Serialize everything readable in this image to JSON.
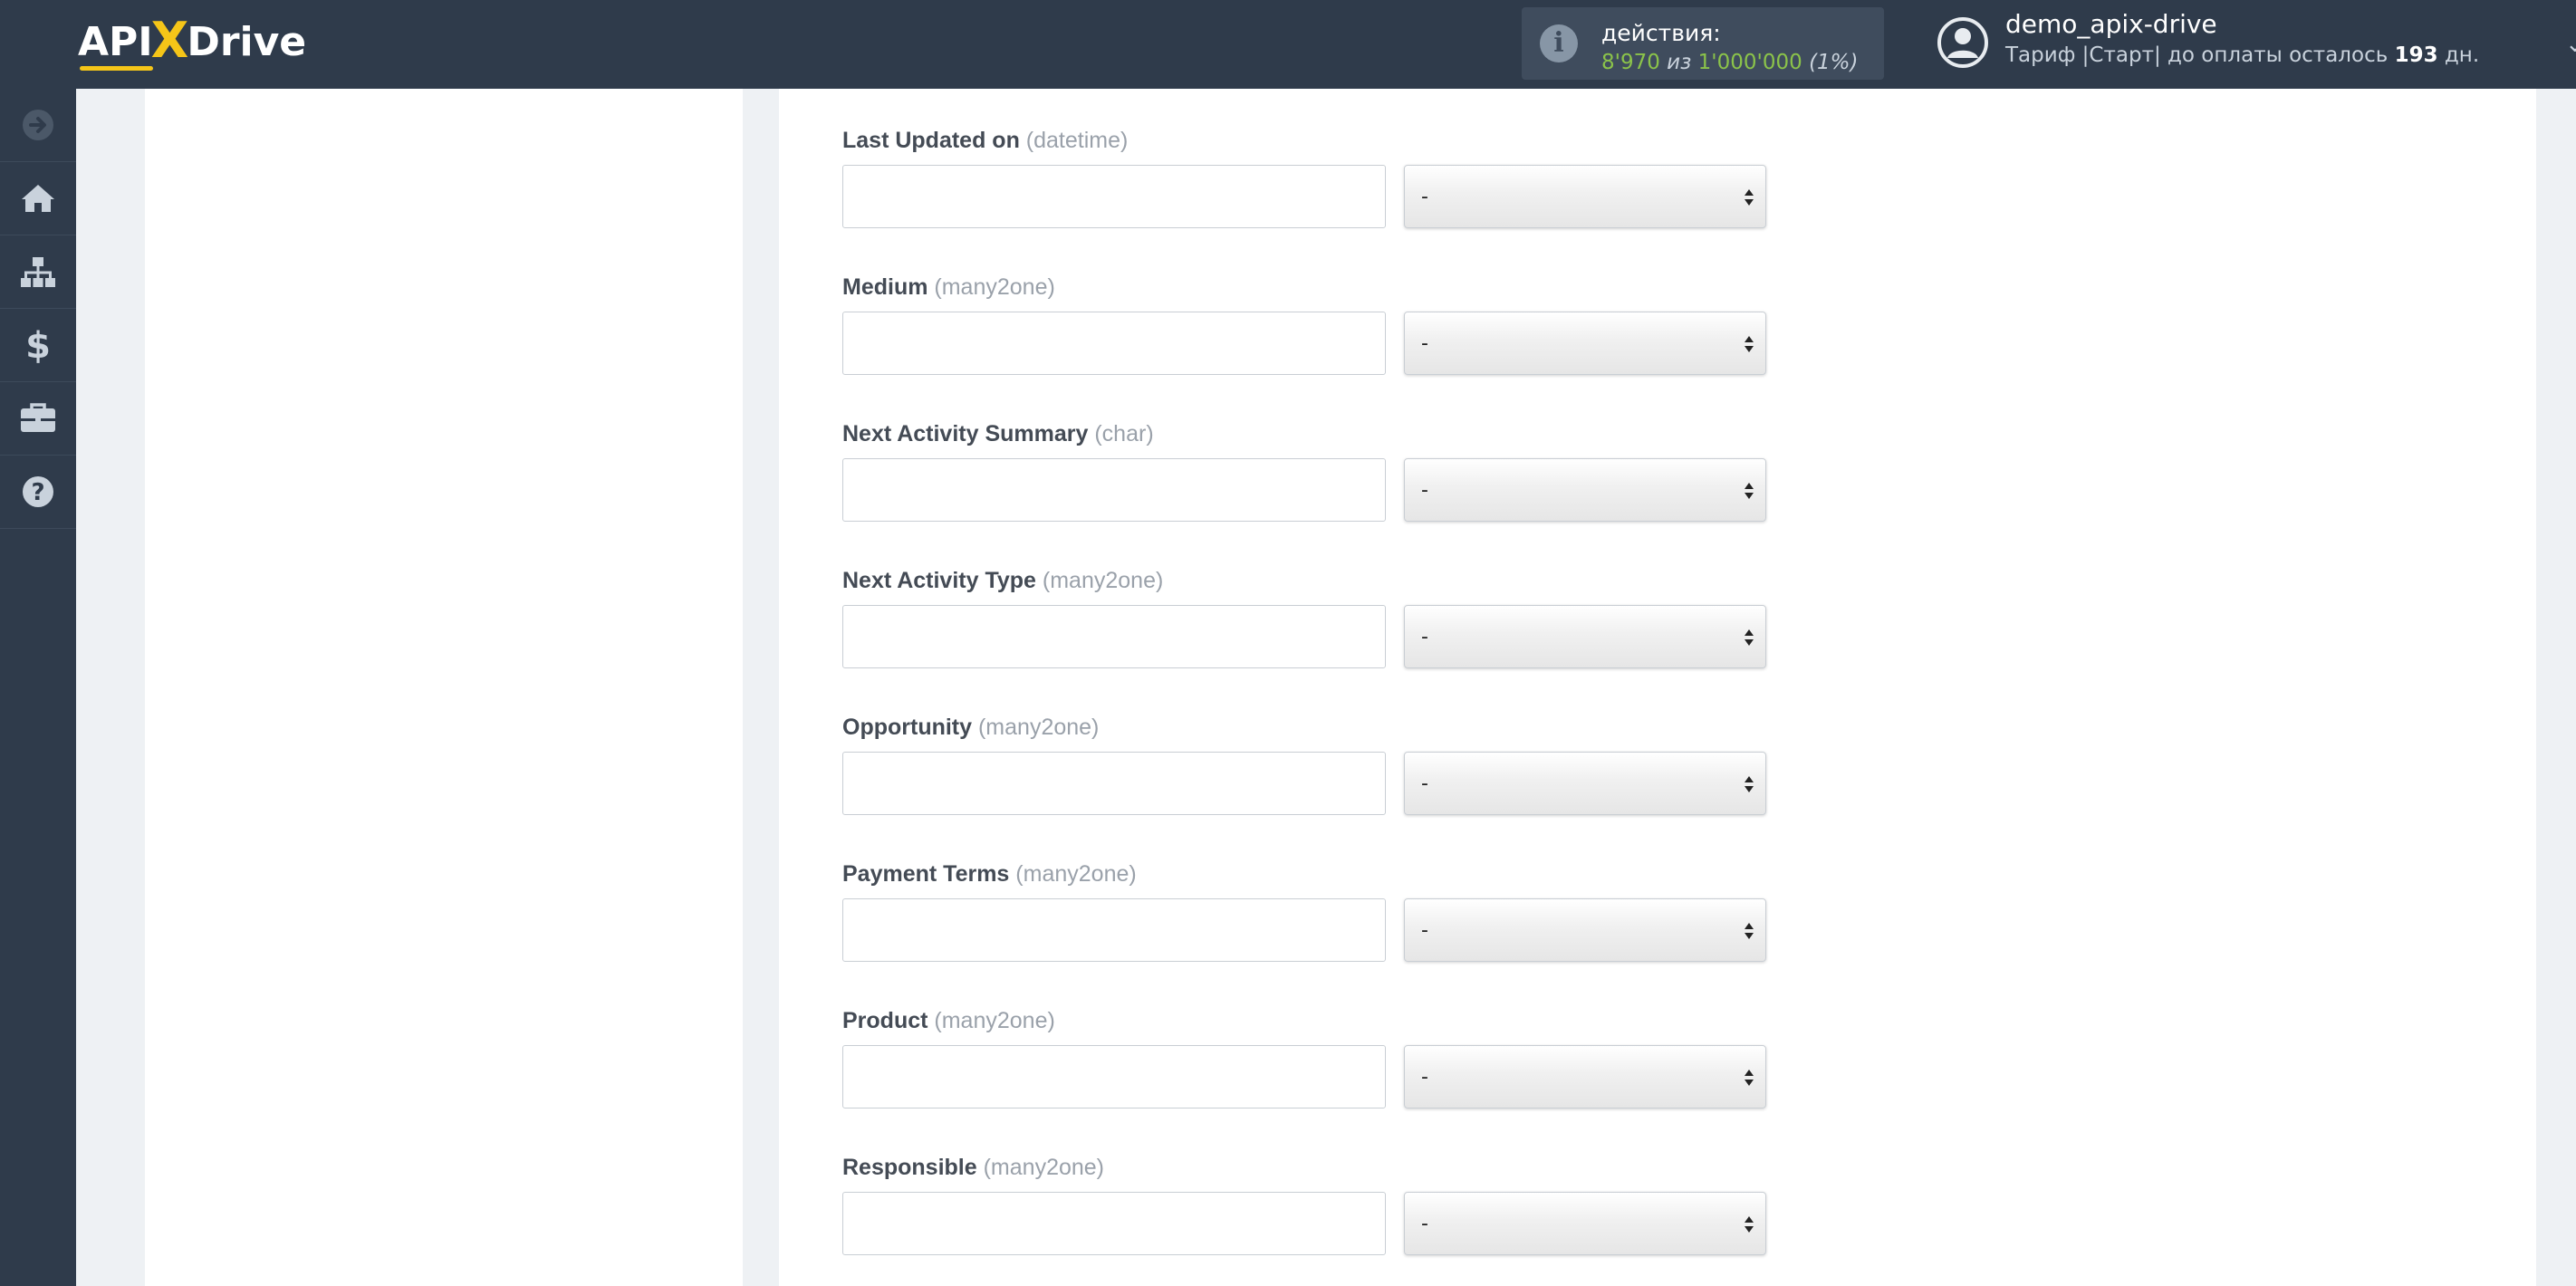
{
  "header": {
    "logo": {
      "part1": "API",
      "part2": "X",
      "part3": "Drive"
    },
    "actions": {
      "label": "действия:",
      "used": "8'970",
      "separator": "из",
      "total": "1'000'000",
      "percent": "(1%)"
    },
    "user": {
      "name": "demo_apix-drive",
      "plan_prefix": "Тариф |Старт| до оплаты осталось",
      "days": "193",
      "days_suffix": "дн."
    }
  },
  "sidebar": {
    "items": [
      {
        "icon": "arrow-right-circle-icon"
      },
      {
        "icon": "home-icon"
      },
      {
        "icon": "sitemap-icon"
      },
      {
        "icon": "dollar-icon"
      },
      {
        "icon": "briefcase-icon"
      },
      {
        "icon": "help-icon"
      }
    ]
  },
  "fields": [
    {
      "label": "Last Updated on",
      "type": "(datetime)",
      "value": "",
      "select": "-"
    },
    {
      "label": "Medium",
      "type": "(many2one)",
      "value": "",
      "select": "-"
    },
    {
      "label": "Next Activity Summary",
      "type": "(char)",
      "value": "",
      "select": "-"
    },
    {
      "label": "Next Activity Type",
      "type": "(many2one)",
      "value": "",
      "select": "-"
    },
    {
      "label": "Opportunity",
      "type": "(many2one)",
      "value": "",
      "select": "-"
    },
    {
      "label": "Payment Terms",
      "type": "(many2one)",
      "value": "",
      "select": "-"
    },
    {
      "label": "Product",
      "type": "(many2one)",
      "value": "",
      "select": "-"
    },
    {
      "label": "Responsible",
      "type": "(many2one)",
      "value": "",
      "select": "-"
    }
  ],
  "colors": {
    "header_bg": "#2f3b4b",
    "accent_yellow": "#f5c518",
    "actions_green": "#8bc34a",
    "page_bg": "#eef1f4"
  }
}
